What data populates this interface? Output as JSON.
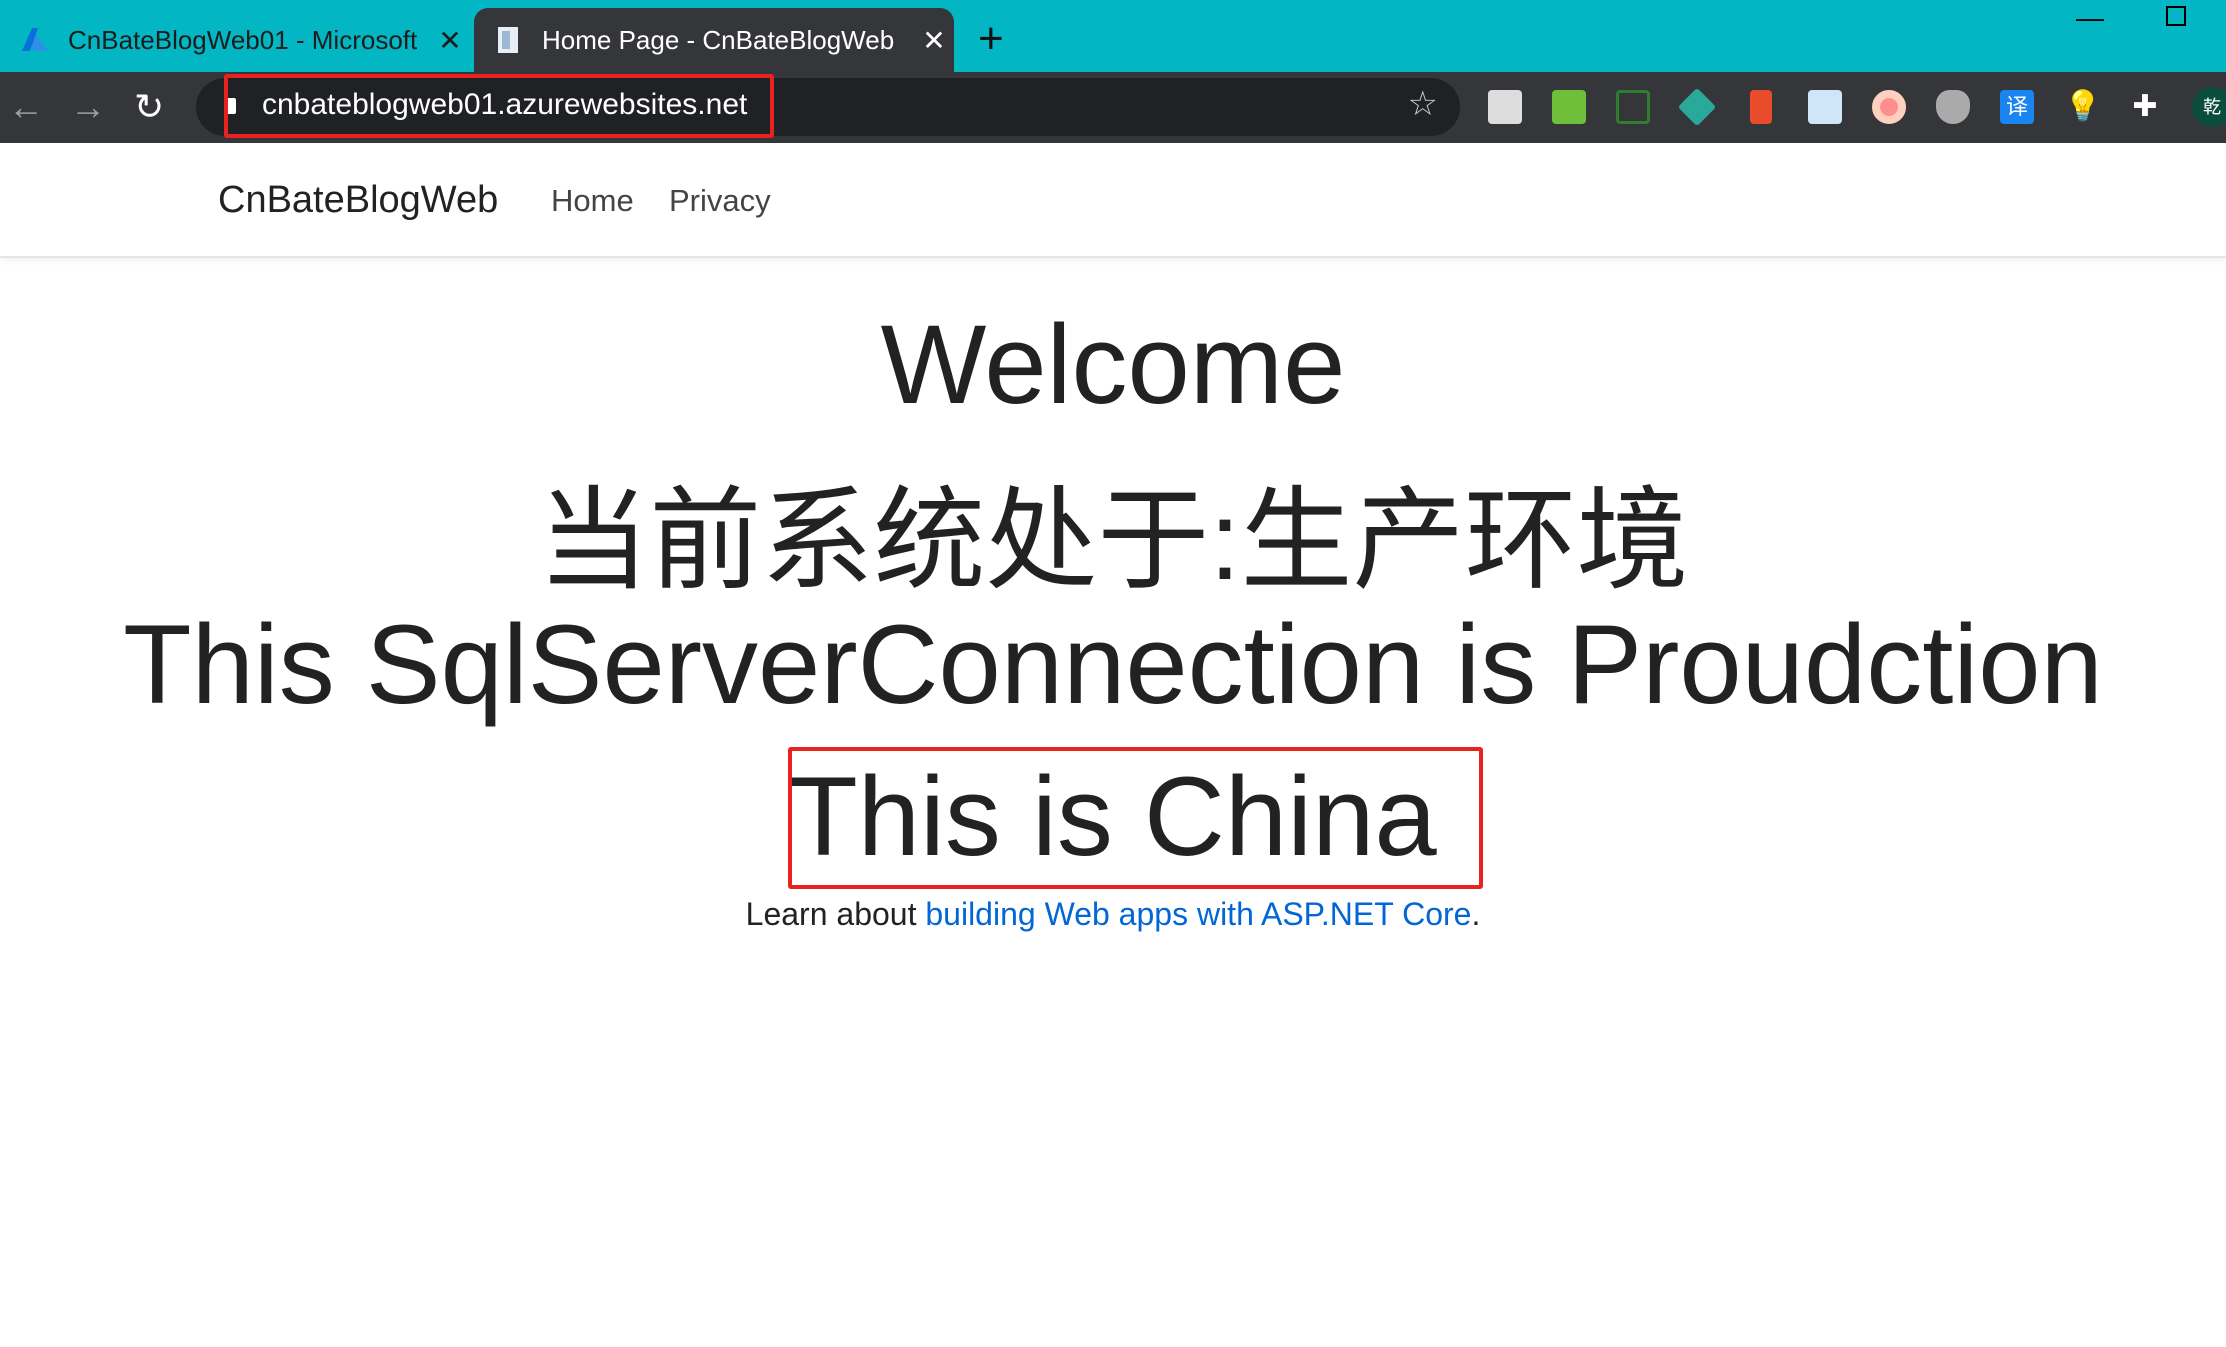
{
  "browser": {
    "tabs": [
      {
        "title": "CnBateBlogWeb01 - Microsoft",
        "icon": "azure-icon",
        "active": false
      },
      {
        "title": "Home Page - CnBateBlogWeb",
        "icon": "page-icon",
        "active": true
      }
    ],
    "close_glyph": "✕",
    "new_tab_glyph": "+",
    "url": "cnbateblogweb01.azurewebsites.net",
    "extensions": [
      "ghostery-icon",
      "grid-extension-icon",
      "screenshot-icon",
      "diamond-extension-icon",
      "lighthouse-icon",
      "reader-icon",
      "circle-extension-icon",
      "bowl-extension-icon",
      "translate-icon",
      "lightbulb-icon",
      "extensions-puzzle-icon"
    ],
    "translate_label": "译",
    "profile_label": "乾",
    "colors": {
      "tabstrip": "#02b6c4",
      "toolbar": "#35363a",
      "highlight": "#e8231f",
      "link": "#0366d6"
    }
  },
  "site": {
    "brand": "CnBateBlogWeb",
    "nav": [
      "Home",
      "Privacy"
    ],
    "heading": "Welcome",
    "environment": "当前系统处于:生产环境",
    "connection": "This SqlServerConnection is Proudction",
    "region": "This is China",
    "learn_prefix": "Learn about ",
    "learn_link": "building Web apps with ASP.NET Core",
    "learn_suffix": "."
  }
}
